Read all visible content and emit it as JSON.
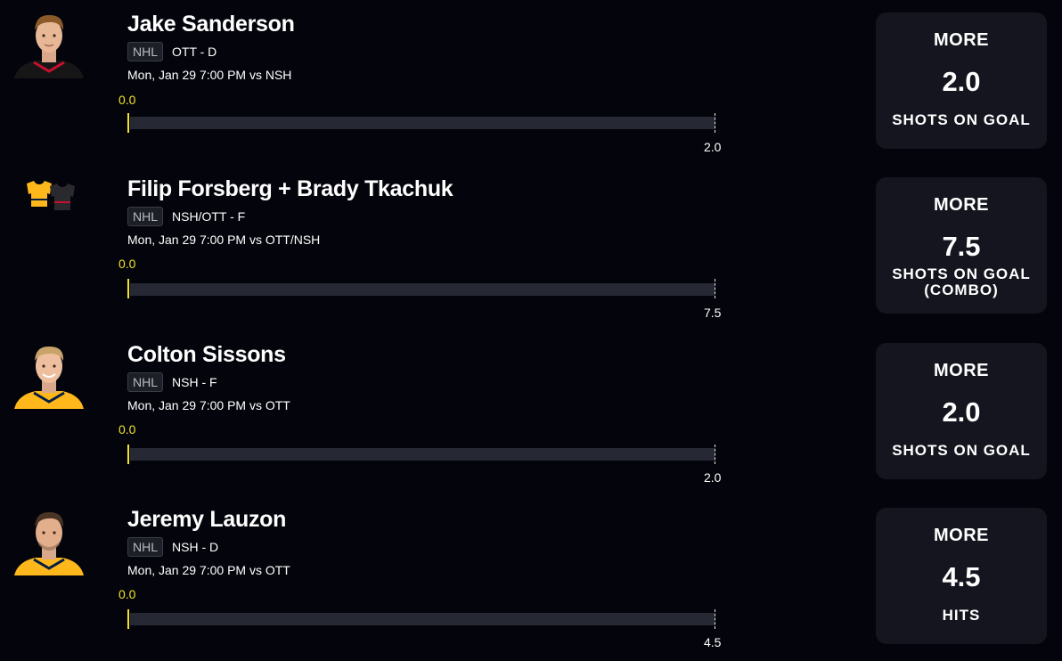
{
  "picks": [
    {
      "player_name": "Jake Sanderson",
      "league": "NHL",
      "team_pos": "OTT - D",
      "game_info": "Mon, Jan 29 7:00 PM  vs NSH",
      "current_value": "0.0",
      "progress_fraction": 0.0,
      "line_value": "2.0",
      "pick": {
        "direction": "MORE",
        "line": "2.0",
        "stat": "SHOTS ON GOAL"
      },
      "avatar": "player-headshot-ottawa",
      "jersey_colors": [
        "#1a1a1a",
        "#c8102e"
      ]
    },
    {
      "player_name": "Filip Forsberg + Brady Tkachuk",
      "league": "NHL",
      "team_pos": "NSH/OTT - F",
      "game_info": "Mon, Jan 29 7:00 PM  vs OTT/NSH",
      "current_value": "0.0",
      "progress_fraction": 0.0,
      "line_value": "7.5",
      "pick": {
        "direction": "MORE",
        "line": "7.5",
        "stat": "SHOTS ON GOAL (COMBO)"
      },
      "avatar": "combo-jerseys-icon",
      "jersey_colors": [
        "#ffb81c",
        "#2a2a2e"
      ]
    },
    {
      "player_name": "Colton Sissons",
      "league": "NHL",
      "team_pos": "NSH - F",
      "game_info": "Mon, Jan 29 7:00 PM  vs OTT",
      "current_value": "0.0",
      "progress_fraction": 0.0,
      "line_value": "2.0",
      "pick": {
        "direction": "MORE",
        "line": "2.0",
        "stat": "SHOTS ON GOAL"
      },
      "avatar": "player-headshot-nashville",
      "jersey_colors": [
        "#ffb81c",
        "#041e42"
      ]
    },
    {
      "player_name": "Jeremy Lauzon",
      "league": "NHL",
      "team_pos": "NSH - D",
      "game_info": "Mon, Jan 29 7:00 PM  vs OTT",
      "current_value": "0.0",
      "progress_fraction": 0.0,
      "line_value": "4.5",
      "pick": {
        "direction": "MORE",
        "line": "4.5",
        "stat": "HITS"
      },
      "avatar": "player-headshot-nashville",
      "jersey_colors": [
        "#ffb81c",
        "#041e42"
      ]
    }
  ],
  "colors": {
    "background": "#04050c",
    "card": "#14151e",
    "track": "#262833",
    "progress": "#f2e22a"
  }
}
